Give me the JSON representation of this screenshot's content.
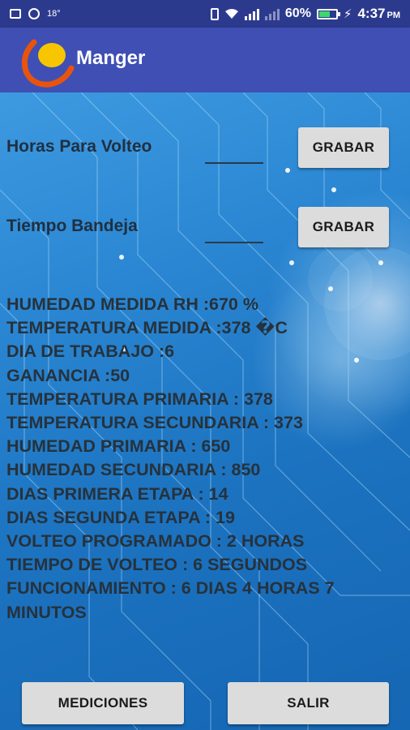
{
  "status_bar": {
    "temperature": "18°",
    "battery_percent": "60%",
    "time": "4:37",
    "ampm": "PM",
    "icons": [
      "image-icon",
      "whatsapp-icon",
      "vibrate-icon",
      "wifi-icon",
      "signal-icon",
      "signal-icon",
      "battery-icon",
      "charging-icon"
    ]
  },
  "app_bar": {
    "title": "Manger",
    "logo_colors": [
      "#f7c600",
      "#e8540d"
    ]
  },
  "form": {
    "horas_label": "Horas Para Volteo",
    "horas_value": "",
    "tiempo_label": "Tiempo Bandeja",
    "tiempo_value": "",
    "grabar_label": "GRABAR"
  },
  "readings": [
    "HUMEDAD MEDIDA RH :670 %",
    "TEMPERATURA MEDIDA :378 �C",
    "DIA DE TRABAJO :6",
    "GANANCIA :50",
    "TEMPERATURA PRIMARIA : 378",
    "TEMPERATURA SECUNDARIA : 373",
    "HUMEDAD PRIMARIA : 650",
    "HUMEDAD SECUNDARIA : 850",
    "DIAS PRIMERA ETAPA : 14",
    "DIAS SEGUNDA ETAPA : 19",
    "VOLTEO PROGRAMADO : 2 HORAS",
    "TIEMPO DE VOLTEO : 6 SEGUNDOS",
    "FUNCIONAMIENTO : 6 DIAS 4 HORAS 7 MINUTOS"
  ],
  "buttons": {
    "mediciones": "MEDICIONES",
    "salir": "SALIR"
  },
  "colors": {
    "status_bar": "#2c3a8e",
    "app_bar": "#3f4fb4",
    "button": "#dcdcdc",
    "text": "#26323c"
  }
}
